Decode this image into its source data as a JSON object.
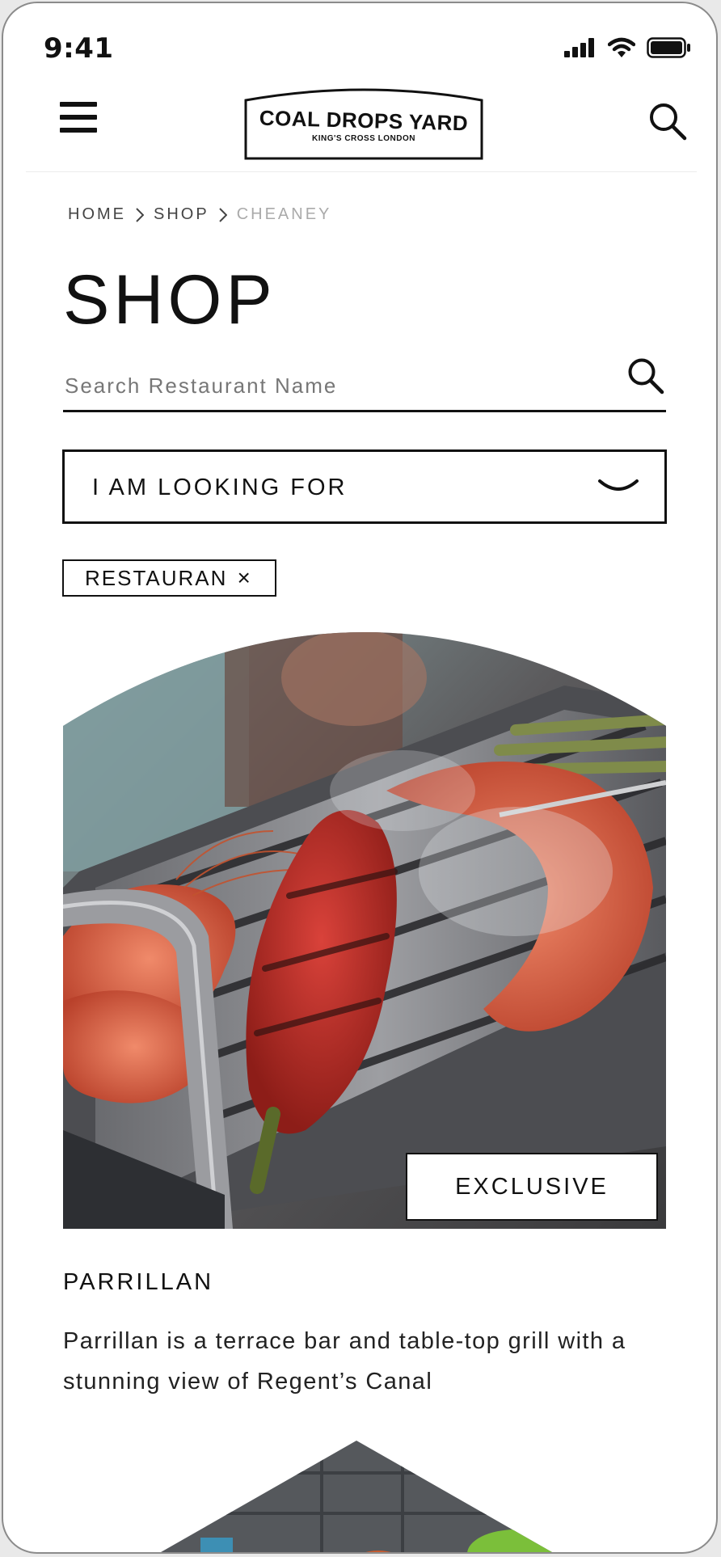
{
  "status_bar": {
    "time": "9:41",
    "icons": [
      "cellular-signal-icon",
      "wifi-icon",
      "battery-icon"
    ]
  },
  "header": {
    "menu_icon": "hamburger-menu-icon",
    "logo_title": "COAL DROPS YARD",
    "logo_subtitle": "KING'S CROSS LONDON",
    "search_icon": "search-icon"
  },
  "breadcrumb": {
    "items": [
      "HOME",
      "SHOP",
      "CHEANEY"
    ]
  },
  "page_title": "SHOP",
  "search": {
    "placeholder": "Search Restaurant Name",
    "value": ""
  },
  "filter_dropdown": {
    "label": "I AM LOOKING FOR",
    "icon": "chevron-down-icon"
  },
  "active_filters": [
    {
      "label": "RESTAURAN",
      "remove_glyph": "×"
    }
  ],
  "listing": {
    "badge": "EXCLUSIVE",
    "title": "PARRILLAN",
    "description": "Parrillan is a terrace bar and table-top grill with a stunning view of Regent’s Canal",
    "image_subject": "table-top grill with prawns and red peppers"
  },
  "colors": {
    "text": "#111111",
    "muted_breadcrumb": "#aaaaaa",
    "background": "#ffffff",
    "frame": "#8b8b8b"
  }
}
